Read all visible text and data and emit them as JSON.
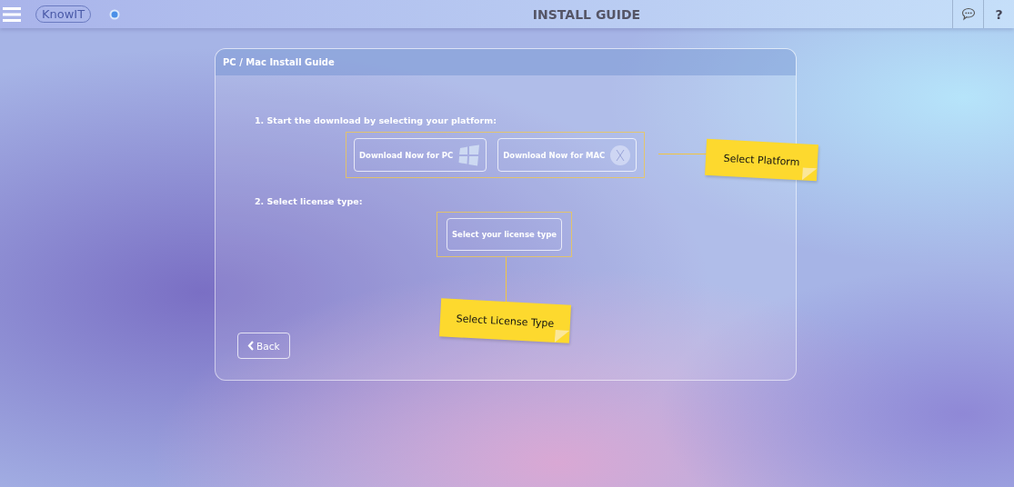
{
  "topbar": {
    "logo": "KnowIT",
    "title": "INSTALL GUIDE",
    "help": "?"
  },
  "card": {
    "title": "PC / Mac Install Guide",
    "step_1": "1. Start the download by selecting your platform:",
    "platform_buttons": [
      {
        "label": "Download Now for PC",
        "kind": "windows"
      },
      {
        "label": "Download Now for MAC",
        "kind": "mac"
      }
    ],
    "step_2": "2. Select license type:",
    "license_button": "Select your license type",
    "back_button": "Back"
  },
  "notes": [
    {
      "text": "Select  Platform"
    },
    {
      "text": "Select License Type"
    }
  ]
}
